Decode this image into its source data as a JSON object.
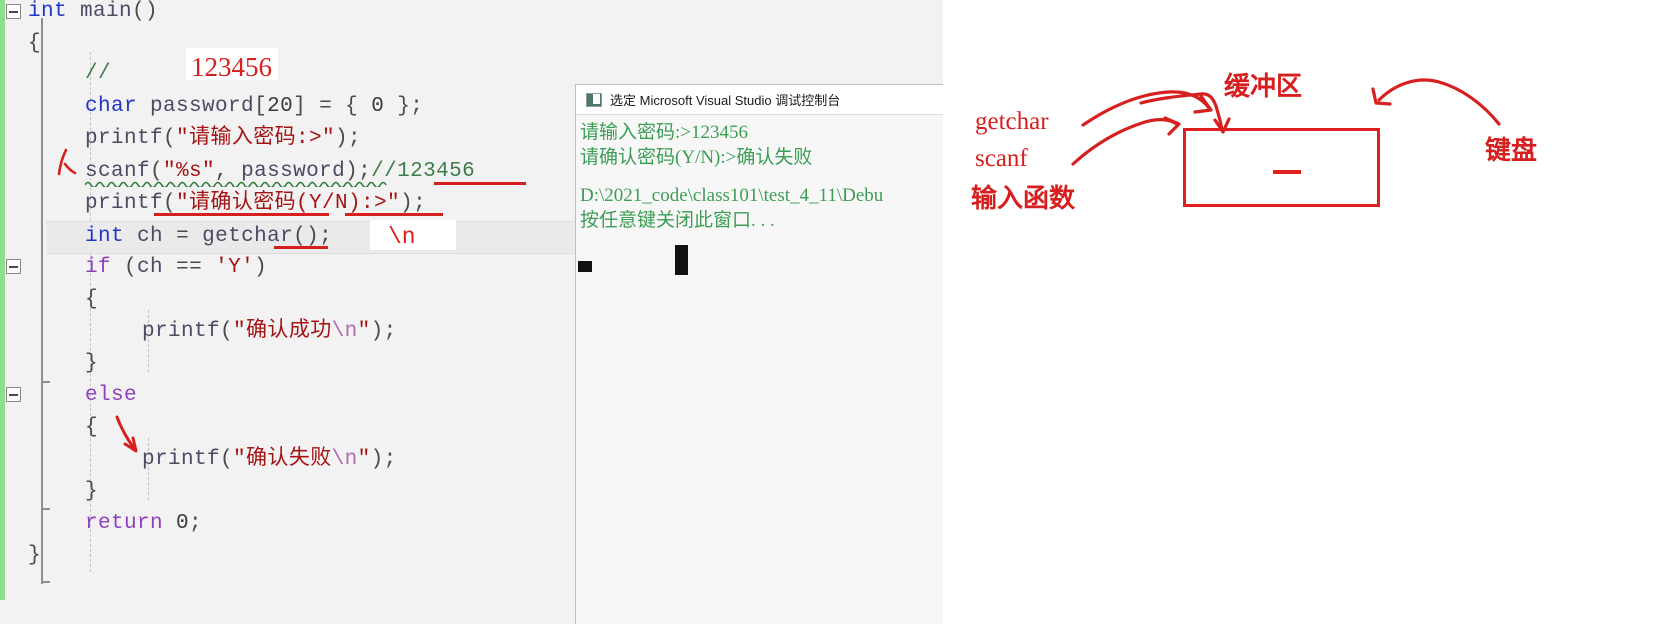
{
  "editor": {
    "name": "visual-studio-code-editor",
    "language": "C",
    "code_lines": [
      {
        "indent": 0,
        "text": "int main()"
      },
      {
        "indent": 1,
        "text": "{"
      },
      {
        "indent": 2,
        "text": "//"
      },
      {
        "indent": 2,
        "text": "char password[20] = { 0 };"
      },
      {
        "indent": 2,
        "text": "printf(\"请输入密码:>\");"
      },
      {
        "indent": 2,
        "text": "scanf(\"%s\", password);//123456"
      },
      {
        "indent": 2,
        "text": "printf(\"请确认密码(Y/N):>\");"
      },
      {
        "indent": 2,
        "text": "int ch = getchar();"
      },
      {
        "indent": 2,
        "text": "if (ch == 'Y')"
      },
      {
        "indent": 2,
        "text": "{"
      },
      {
        "indent": 3,
        "text": "printf(\"确认成功\\n\");"
      },
      {
        "indent": 2,
        "text": "}"
      },
      {
        "indent": 2,
        "text": "else"
      },
      {
        "indent": 2,
        "text": "{"
      },
      {
        "indent": 3,
        "text": "printf(\"确认失败\\n\");"
      },
      {
        "indent": 2,
        "text": "}"
      },
      {
        "indent": 2,
        "text": "return 0;"
      },
      {
        "indent": 1,
        "text": "}"
      }
    ],
    "tokens": {
      "kw_int": "int",
      "kw_char": "char",
      "kw_if": "if",
      "kw_else": "else",
      "kw_return": "return",
      "fn_main": "main",
      "fn_printf": "printf",
      "fn_scanf": "scanf",
      "fn_getchar": "getchar",
      "var_password": "password",
      "var_ch": "ch",
      "str_prompt_input": "\"请输入密码:>\"",
      "str_fmt_s": "\"%s\"",
      "str_prompt_confirm": "\"请确认密码(Y/N):>\"",
      "str_success": "\"确认成功",
      "str_fail": "\"确认失败",
      "escape_n": "\\n",
      "char_Y": "'Y'",
      "comment_slashes": "//",
      "comment_123456": "//123456",
      "array_size": "[20]",
      "init_zero": "{ 0 }",
      "ret_zero": "0"
    },
    "annotations": {
      "red_123456": "123456",
      "red_backslash_n": "\\n",
      "colors": {
        "keyword_blue": "#1f37c4",
        "keyword_purple": "#8f3fbf",
        "string_maroon": "#a31515",
        "comment_green": "#3c7d4b",
        "identifier": "#4b4b63",
        "ink_red": "#d62020",
        "change_bar_green": "#8ddf8d",
        "editor_background": "#f2f2f2"
      }
    }
  },
  "console": {
    "title": "选定 Microsoft Visual Studio 调试控制台",
    "icon": "console-window-icon",
    "text_color": "#3c9e55",
    "lines": [
      "请输入密码:>123456",
      "请确认密码(Y/N):>确认失败",
      "",
      "D:\\2021_code\\class101\\test_4_11\\Debu",
      "按任意键关闭此窗口. . ."
    ]
  },
  "diagram": {
    "labels": {
      "getchar": "getchar",
      "scanf": "scanf",
      "input_function": "输入函数",
      "buffer": "缓冲区",
      "keyboard": "键盘"
    },
    "box": {
      "name": "buffer-box",
      "border_color": "#e02020",
      "content_mark": "—"
    },
    "arrows": [
      {
        "name": "getchar-to-buffer-arrow",
        "from": "getchar",
        "to": "buffer-box"
      },
      {
        "name": "scanf-to-buffer-arrow",
        "from": "scanf",
        "to": "buffer-box"
      },
      {
        "name": "buffer-label-pointer",
        "from": "缓冲区",
        "to": "buffer-box"
      },
      {
        "name": "keyboard-to-buffer-arrow",
        "from": "键盘",
        "to": "buffer-box"
      }
    ]
  }
}
